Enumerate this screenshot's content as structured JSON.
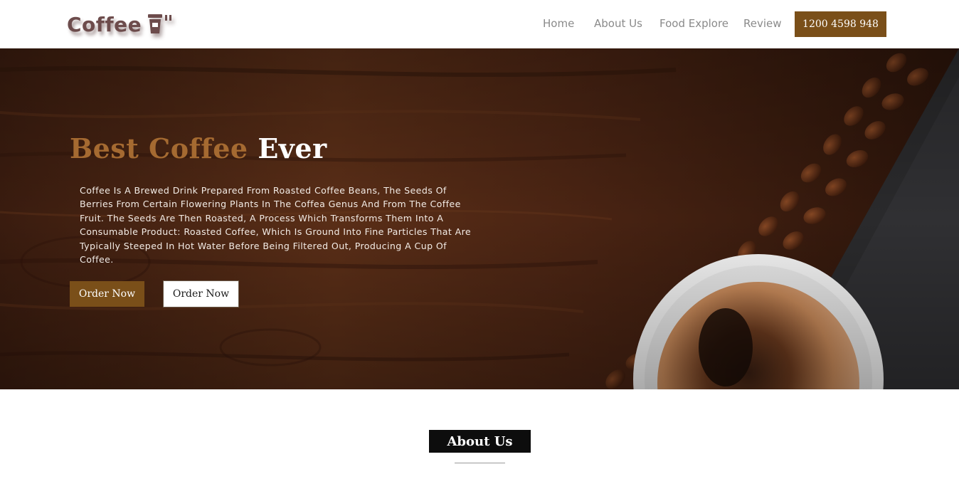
{
  "header": {
    "logo_text": "Coffee",
    "logo_icon": "coffee-cup-icon",
    "nav": {
      "home": "Home",
      "about": "About Us",
      "food": "Food Explore",
      "review": "Review"
    },
    "phone": "1200 4598 948"
  },
  "hero": {
    "title_accent": "Best Coffee",
    "title_rest": "Ever",
    "description": "Coffee Is A Brewed Drink Prepared From Roasted Coffee Beans, The Seeds Of Berries From Certain Flowering Plants In The Coffea Genus And From The Coffee Fruit. The Seeds Are Then Roasted, A Process Which Transforms Them Into A Consumable Product: Roasted Coffee, Which Is Ground Into Fine Particles That Are Typically Steeped In Hot Water Before Being Filtered Out, Producing A Cup Of Coffee.",
    "primary_button": "Order Now",
    "secondary_button": "Order Now"
  },
  "about": {
    "heading": "About Us"
  },
  "colors": {
    "brand_brown": "#7a4f19",
    "title_accent": "#a56a31",
    "nav_text": "#8a8a8a",
    "heading_bg": "#0d0d0d"
  }
}
